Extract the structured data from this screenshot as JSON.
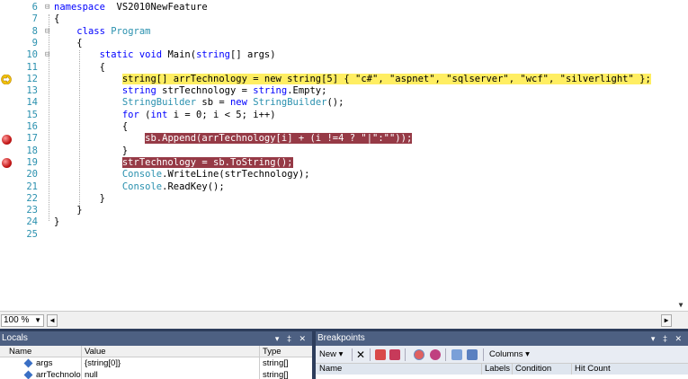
{
  "editor": {
    "lines": [
      {
        "num": "6",
        "fold": "⊟",
        "code": [
          [
            "kw",
            "namespace"
          ],
          [
            "",
            "  VS2010NewFeature"
          ]
        ]
      },
      {
        "num": "7",
        "fold": "",
        "code": [
          [
            "",
            "{"
          ]
        ]
      },
      {
        "num": "8",
        "fold": "⊟",
        "code": [
          [
            "",
            "    "
          ],
          [
            "kw",
            "class"
          ],
          [
            "",
            " "
          ],
          [
            "ty",
            "Program"
          ]
        ]
      },
      {
        "num": "9",
        "fold": "",
        "code": [
          [
            "",
            "    {"
          ]
        ]
      },
      {
        "num": "10",
        "fold": "⊟",
        "code": [
          [
            "",
            "        "
          ],
          [
            "kw",
            "static void"
          ],
          [
            "",
            " Main("
          ],
          [
            "kw",
            "string"
          ],
          [
            "",
            "[] args)"
          ]
        ]
      },
      {
        "num": "11",
        "fold": "",
        "code": [
          [
            "",
            "        {"
          ]
        ]
      },
      {
        "num": "12",
        "fold": "",
        "code": [
          [
            "",
            "            "
          ],
          [
            "hly",
            "string[] arrTechnology = new string[5] { \"c#\", \"aspnet\", \"sqlserver\", \"wcf\", \"silverlight\" };"
          ]
        ]
      },
      {
        "num": "13",
        "fold": "",
        "code": [
          [
            "",
            "            "
          ],
          [
            "kw",
            "string"
          ],
          [
            "",
            " strTechnology = "
          ],
          [
            "kw",
            "string"
          ],
          [
            "",
            ".Empty;"
          ]
        ]
      },
      {
        "num": "14",
        "fold": "",
        "code": [
          [
            "",
            "            "
          ],
          [
            "ty",
            "StringBuilder"
          ],
          [
            "",
            " sb = "
          ],
          [
            "kw",
            "new"
          ],
          [
            "",
            " "
          ],
          [
            "ty",
            "StringBuilder"
          ],
          [
            "",
            "();"
          ]
        ]
      },
      {
        "num": "15",
        "fold": "",
        "code": [
          [
            "",
            "            "
          ],
          [
            "kw",
            "for"
          ],
          [
            "",
            " ("
          ],
          [
            "kw",
            "int"
          ],
          [
            "",
            " i = 0; i < 5; i++)"
          ]
        ]
      },
      {
        "num": "16",
        "fold": "",
        "code": [
          [
            "",
            "            {"
          ]
        ]
      },
      {
        "num": "17",
        "fold": "",
        "code": [
          [
            "",
            "                "
          ],
          [
            "hlb",
            "sb.Append(arrTechnology[i] + (i !=4 ? \"|\":\"\"));"
          ]
        ]
      },
      {
        "num": "18",
        "fold": "",
        "code": [
          [
            "",
            "            }"
          ]
        ]
      },
      {
        "num": "19",
        "fold": "",
        "code": [
          [
            "",
            "            "
          ],
          [
            "hlb",
            "strTechnology = sb.ToString();"
          ]
        ]
      },
      {
        "num": "20",
        "fold": "",
        "code": [
          [
            "",
            "            "
          ],
          [
            "ty",
            "Console"
          ],
          [
            "",
            ".WriteLine(strTechnology);"
          ]
        ]
      },
      {
        "num": "21",
        "fold": "",
        "code": [
          [
            "",
            "            "
          ],
          [
            "ty",
            "Console"
          ],
          [
            "",
            ".ReadKey();"
          ]
        ]
      },
      {
        "num": "22",
        "fold": "",
        "code": [
          [
            "",
            "        }"
          ]
        ]
      },
      {
        "num": "23",
        "fold": "",
        "code": [
          [
            "",
            "    }"
          ]
        ]
      },
      {
        "num": "24",
        "fold": "",
        "code": [
          [
            "",
            "}"
          ]
        ]
      },
      {
        "num": "25",
        "fold": "",
        "code": [
          [
            "",
            ""
          ]
        ]
      }
    ],
    "current_line": "12",
    "breakpoint_lines": [
      "17",
      "19"
    ]
  },
  "statusbar": {
    "zoom": "100 %"
  },
  "locals": {
    "title": "Locals",
    "controls": "▾ ‡ ✕",
    "columns": [
      "Name",
      "Value",
      "Type"
    ],
    "rows": [
      {
        "name": "args",
        "value": "{string[0]}",
        "type": "string[]"
      },
      {
        "name": "arrTechnolo",
        "value": "null",
        "type": "string[]"
      }
    ]
  },
  "breakpoints": {
    "title": "Breakpoints",
    "controls": "▾ ‡ ✕",
    "new_label": "New ▾",
    "columns_label": "Columns ▾",
    "headers": [
      "Name",
      "Labels",
      "Condition",
      "Hit Count"
    ]
  },
  "colors": {
    "keyword": "#0000ff",
    "type": "#2b91af",
    "current_line": "#ffee62",
    "breakpoint_line": "#963a46",
    "panel_title": "#4d6082"
  }
}
